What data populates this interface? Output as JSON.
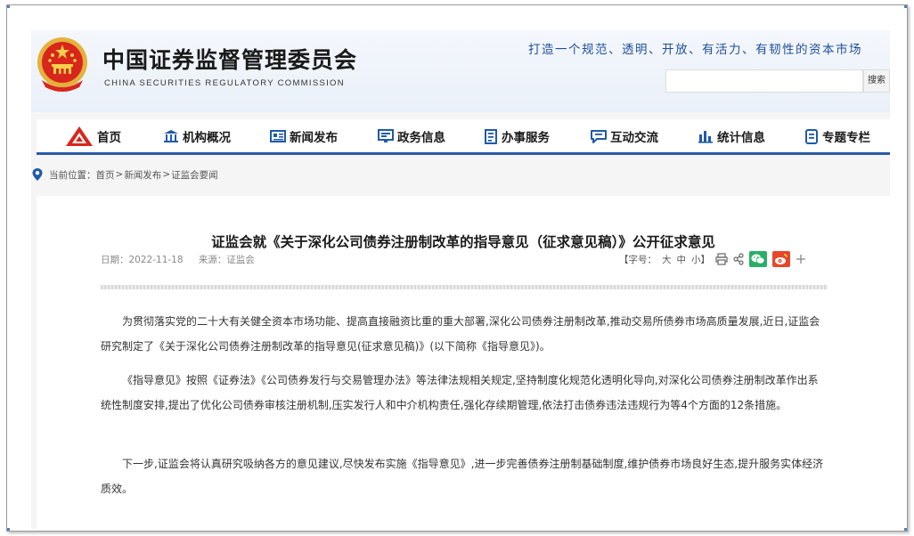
{
  "header": {
    "site_name_cn": "中国证券监督管理委员会",
    "site_name_en": "CHINA SECURITIES REGULATORY COMMISSION",
    "slogan": "打造一个规范、透明、开放、有活力、有韧性的资本市场",
    "search_placeholder": "",
    "search_button": "搜索",
    "emblem_icon": "national-emblem-icon"
  },
  "nav": {
    "items": [
      {
        "label": "首页",
        "icon": "logo-icon"
      },
      {
        "label": "机构概况",
        "icon": "building-icon"
      },
      {
        "label": "新闻发布",
        "icon": "news-icon"
      },
      {
        "label": "政务信息",
        "icon": "monitor-icon"
      },
      {
        "label": "办事服务",
        "icon": "document-icon"
      },
      {
        "label": "互动交流",
        "icon": "chat-icon"
      },
      {
        "label": "统计信息",
        "icon": "bar-chart-icon"
      },
      {
        "label": "专题专栏",
        "icon": "bookmark-icon"
      }
    ]
  },
  "breadcrumb": {
    "prefix": "当前位置：",
    "items": [
      "首页",
      "新闻发布",
      "证监会要闻"
    ],
    "separator": ">"
  },
  "article": {
    "title": "证监会就《关于深化公司债券注册制改革的指导意见（征求意见稿）》公开征求意见",
    "date": "日期：2022-11-18",
    "source": "来源：证监会",
    "font_size_label": "【字号：",
    "font_large": "大",
    "font_medium": "中",
    "font_small": "小】",
    "paragraphs": [
      "为贯彻落实党的二十大有关健全资本市场功能、提高直接融资比重的重大部署,深化公司债券注册制改革,推动交易所债券市场高质量发展,近日,证监会研究制定了《关于深化公司债券注册制改革的指导意见(征求意见稿)》(以下简称《指导意见》)。",
      "《指导意见》按照《证券法》《公司债券发行与交易管理办法》等法律法规相关规定,坚持制度化规范化透明化导向,对深化公司债券注册制改革作出系统性制度安排,提出了优化公司债券审核注册机制,压实发行人和中介机构责任,强化存续期管理,依法打击债券违法违规行为等4个方面的12条措施。",
      "下一步,证监会将认真研究吸纳各方的意见建议,尽快发布实施《指导意见》,进一步完善债券注册制基础制度,维护债券市场良好生态,提升服务实体经济质效。"
    ]
  },
  "colors": {
    "nav_underline": "#2a5ba8",
    "slogan": "#1d4f9b",
    "wechat": "#2aae67",
    "weibo": "#e6462c"
  }
}
